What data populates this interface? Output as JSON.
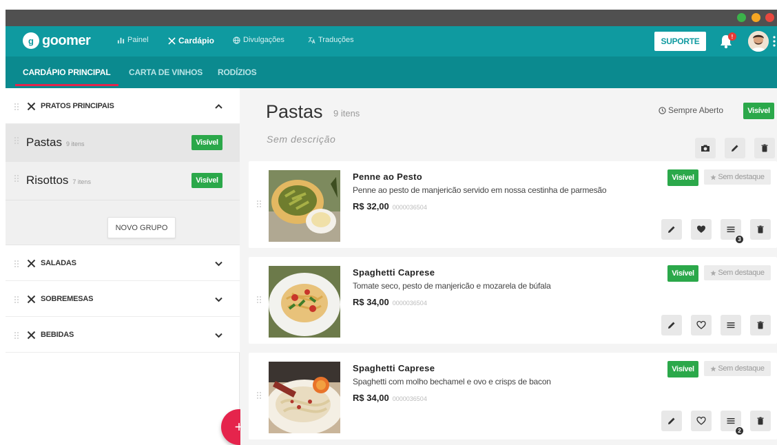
{
  "window": {
    "dots": [
      {
        "name": "green-dot",
        "color": "#3bb34a"
      },
      {
        "name": "yellow-dot",
        "color": "#f5a623"
      },
      {
        "name": "red-dot",
        "color": "#e8483f"
      }
    ]
  },
  "colors": {
    "primary": "#0f9aa0",
    "primary_dark": "#0b8a8f",
    "accent": "#e5244c",
    "visible_green": "#2ba84a"
  },
  "topnav": {
    "logo_mark": "g",
    "logo_text": "goomer",
    "links": [
      {
        "label": "Painel",
        "icon": "bar-chart-icon"
      },
      {
        "label": "Cardápio",
        "icon": "utensils-icon"
      },
      {
        "label": "Divulgações",
        "icon": "globe-icon"
      },
      {
        "label": "Traduções",
        "icon": "translate-icon"
      }
    ],
    "suporte": "SUPORTE",
    "notification_count": "!"
  },
  "subnav": {
    "tabs": [
      {
        "label": "CARDÁPIO PRINCIPAL"
      },
      {
        "label": "CARTA DE VINHOS"
      },
      {
        "label": "RODÍZIOS"
      }
    ]
  },
  "sidebar": {
    "categories": [
      {
        "label": "PRATOS PRINCIPAIS",
        "expanded": true
      },
      {
        "label": "SALADAS",
        "expanded": false
      },
      {
        "label": "SOBREMESAS",
        "expanded": false
      },
      {
        "label": "BEBIDAS",
        "expanded": false
      }
    ],
    "groups": [
      {
        "name": "Pastas",
        "count": "9 itens",
        "status": "Visível",
        "selected": true
      },
      {
        "name": "Risottos",
        "count": "7 itens",
        "status": "Visível",
        "selected": false
      }
    ],
    "new_group": "NOVO GRUPO",
    "fab": "+"
  },
  "section": {
    "title": "Pastas",
    "count": "9 itens",
    "description": "Sem descrição",
    "schedule": "Sempre Aberto",
    "status": "Visível"
  },
  "items": [
    {
      "title": "Penne ao Pesto",
      "description": "Penne ao pesto de manjericão servido em nossa cestinha de parmesão",
      "price": "R$ 32,00",
      "code": "0000036504",
      "status": "Visível",
      "highlight": "Sem destaque",
      "favorite": true,
      "options_count": "3"
    },
    {
      "title": "Spaghetti Caprese",
      "description": "Tomate seco, pesto de manjericão e mozarela de búfala",
      "price": "R$ 34,00",
      "code": "0000036504",
      "status": "Visível",
      "highlight": "Sem destaque",
      "favorite": false,
      "options_count": ""
    },
    {
      "title": "Spaghetti Caprese",
      "description": "Spaghetti com molho bechamel e ovo e crisps de bacon",
      "price": "R$ 34,00",
      "code": "0000036504",
      "status": "Visível",
      "highlight": "Sem destaque",
      "favorite": false,
      "options_count": "2"
    }
  ]
}
